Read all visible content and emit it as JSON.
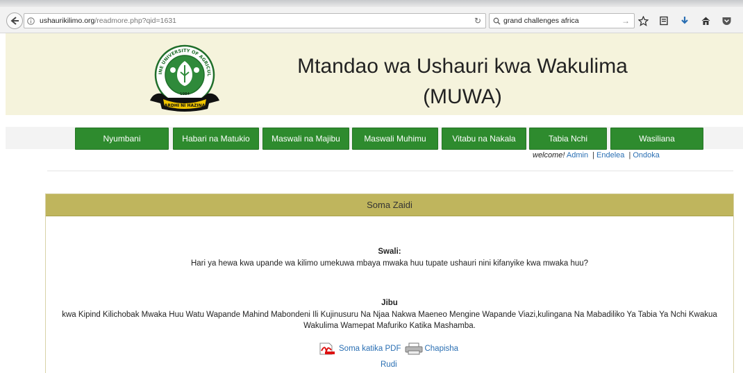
{
  "browser": {
    "url_host": "ushaurikilimo.org",
    "url_path": "/readmore.php?qid=1631",
    "search_value": "grand challenges africa",
    "icons": [
      "back-icon",
      "info-icon",
      "reload-icon",
      "search-icon",
      "forward-arrow-icon",
      "star-icon",
      "reading-list-icon",
      "download-icon",
      "home-icon",
      "pocket-icon"
    ]
  },
  "header": {
    "title_line1": "Mtandao wa Ushauri kwa Wakulima",
    "title_line2": "(MUWA)",
    "logo": {
      "ring_text": "SOKOINE UNIVERSITY OF AGRICULTURE",
      "year": "1984",
      "motto": "ARDHI NI HAZINA"
    }
  },
  "nav": {
    "items": [
      {
        "label": "Nyumbani"
      },
      {
        "label": "Habari na Matukio"
      },
      {
        "label": "Maswali na Majibu"
      },
      {
        "label": "Maswali Muhimu"
      },
      {
        "label": "Vitabu na Nakala"
      },
      {
        "label": "Tabia Nchi"
      },
      {
        "label": "Wasiliana"
      }
    ],
    "accent_color": "#2e8b2e"
  },
  "user_bar": {
    "welcome_label": "welcome!",
    "user_link": "Admin",
    "separator": "|",
    "continue_link": "Endelea",
    "logout_link": "Ondoka"
  },
  "panel": {
    "title": "Soma Zaidi",
    "header_color": "#bfb55d",
    "question_label": "Swali:",
    "question_text": "Hari ya hewa kwa upande wa kilimo umekuwa mbaya mwaka huu tupate ushauri nini kifanyike kwa mwaka huu?",
    "answer_label": "Jibu",
    "answer_line1": "kwa Kipind Kilichobak Mwaka Huu Watu Wapande Mahind Mabondeni Ili Kujinusuru Na Njaa Nakwa Maeneo Mengine Wapande Viazi,kulingana Na Mabadiliko Ya Tabia Ya Nchi Kwakua",
    "answer_line2": "Wakulima Wamepat Mafuriko Katika Mashamba.",
    "pdf_link": "Soma katika PDF",
    "print_link": "Chapisha",
    "back_link": "Rudi"
  }
}
